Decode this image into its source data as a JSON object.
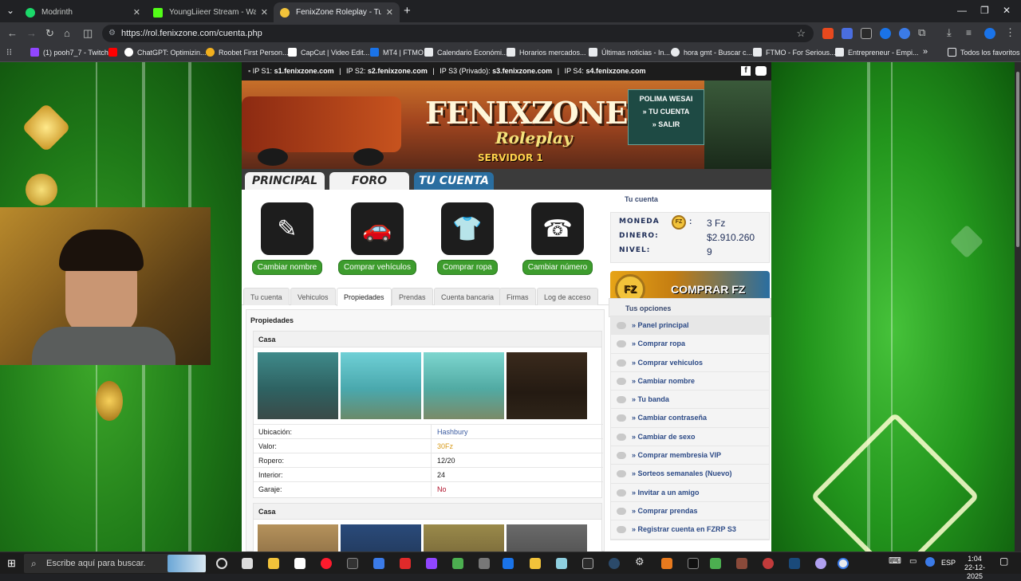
{
  "browser": {
    "tabs": [
      {
        "title": "Modrinth",
        "fav_color": "#1bd96a"
      },
      {
        "title": "YoungLiieer Stream - Watch Live",
        "fav_color": "#53fc18"
      },
      {
        "title": "FenixZone Roleplay - Tu cuenta",
        "fav_color": "#f2c33a"
      }
    ],
    "new_tab": "+",
    "url": "https://rol.fenixzone.com/cuenta.php",
    "bookmarks": [
      {
        "label": "(1) pooh7_7 - Twitch",
        "color": "#9146ff"
      },
      {
        "label": "",
        "color": "#ff0000"
      },
      {
        "label": "ChatGPT: Optimizin...",
        "color": "#ffffff"
      },
      {
        "label": "Roobet First Person...",
        "color": "#f2b01e"
      },
      {
        "label": "CapCut | Video Edit...",
        "color": "#ffffff"
      },
      {
        "label": "MT4 | FTMO",
        "color": "#1a73e8"
      },
      {
        "label": "Calendario Económi...",
        "color": "#e8eaed"
      },
      {
        "label": "Horarios mercados...",
        "color": "#e8eaed"
      },
      {
        "label": "Últimas noticias - In...",
        "color": "#e8eaed"
      },
      {
        "label": "hora gmt - Buscar c...",
        "color": "#e8eaed"
      },
      {
        "label": "FTMO - For Serious...",
        "color": "#e8eaed"
      },
      {
        "label": "Entrepreneur - Empi...",
        "color": "#e8eaed"
      }
    ],
    "more_bookmarks": "»",
    "all_bookmarks": "Todos los favoritos"
  },
  "site": {
    "ip_bar": {
      "s1_label": "IP S1:",
      "s1": "s1.fenixzone.com",
      "s2_label": "IP S2:",
      "s2": "s2.fenixzone.com",
      "s3_label": "IP S3 (Privado):",
      "s3": "s3.fenixzone.com",
      "s4_label": "IP S4:",
      "s4": "s4.fenixzone.com",
      "sep": "|"
    },
    "banner": {
      "logo": "FENIXZONE",
      "logo_sub": "Roleplay",
      "server": "SERVIDOR 1",
      "user": "POLIMA WESAI",
      "account_link": "» TU CUENTA",
      "exit_link": "» SALIR"
    },
    "nav_tabs": [
      "PRINCIPAL",
      "FORO",
      "TU CUENTA"
    ],
    "actions": [
      {
        "icon": "document-pen-icon",
        "glyph": "✎",
        "label": "Cambiar nombre"
      },
      {
        "icon": "car-icon",
        "glyph": "🚗",
        "label": "Comprar vehículos"
      },
      {
        "icon": "clothes-icon",
        "glyph": "👕",
        "label": "Comprar ropa"
      },
      {
        "icon": "phone-icon",
        "glyph": "☎",
        "label": "Cambiar número"
      }
    ],
    "sub_tabs": [
      "Tu cuenta",
      "Vehiculos",
      "Propiedades",
      "Prendas",
      "Cuenta bancaria",
      "Firmas",
      "Log de acceso"
    ],
    "section_title": "Propiedades",
    "properties": [
      {
        "title": "Casa",
        "rows": [
          {
            "k": "Ubicación:",
            "v": "Hashbury",
            "color": "#3a5aa0"
          },
          {
            "k": "Valor:",
            "v": "30Fz",
            "color": "#d89a1a"
          },
          {
            "k": "Ropero:",
            "v": "12/20",
            "color": "#222222"
          },
          {
            "k": "Interior:",
            "v": "24",
            "color": "#222222"
          },
          {
            "k": "Garaje:",
            "v": "No",
            "color": "#b0112a"
          }
        ]
      },
      {
        "title": "Casa"
      }
    ],
    "sidebar": {
      "account_title": "Tu cuenta",
      "stats": [
        {
          "k": "MONEDA",
          "v": "3 Fz"
        },
        {
          "k": "DINERO:",
          "v": "$2.910.260"
        },
        {
          "k": "NIVEL:",
          "v": "9"
        }
      ],
      "coin_symbol": "FZ",
      "stat_sep": ":",
      "buy_fz": "COMPRAR FZ",
      "options_title": "Tus opciones",
      "options": [
        "» Panel principal",
        "» Comprar ropa",
        "» Comprar vehiculos",
        "» Cambiar nombre",
        "» Tu banda",
        "» Cambiar contraseña",
        "» Cambiar de sexo",
        "» Comprar membresia VIP",
        "» Sorteos semanales (Nuevo)",
        "» Invitar a un amigo",
        "» Comprar prendas",
        "» Registrar cuenta en FZRP S3"
      ]
    }
  },
  "taskbar": {
    "search_placeholder": "Escribe aquí para buscar.",
    "lang": "ESP",
    "time": "1:04",
    "date": "22-12-2025"
  },
  "colors": {
    "accent": "#3d9c2d",
    "nav_active": "#2a6ea0",
    "link": "#2c4a86"
  }
}
